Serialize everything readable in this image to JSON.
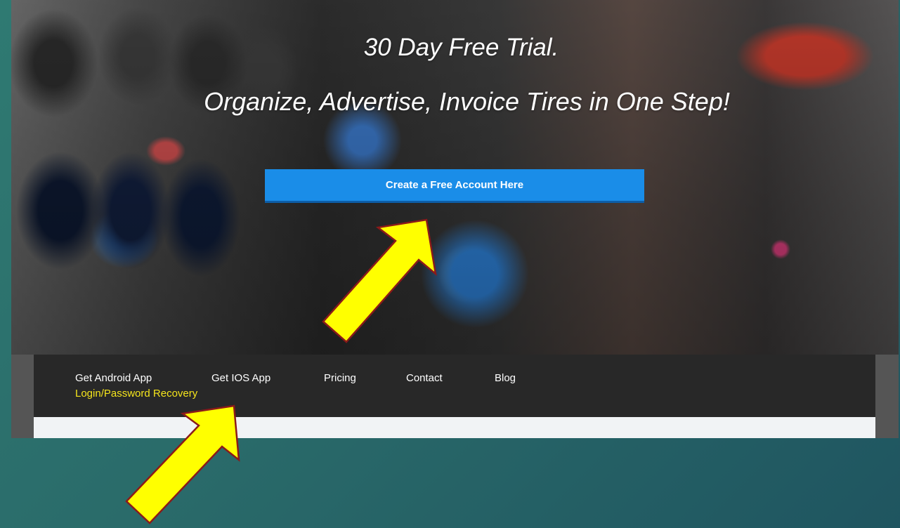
{
  "hero": {
    "headline_1": "30 Day Free Trial.",
    "headline_2": "Organize, Advertise, Invoice Tires in One Step!",
    "cta_label": "Create a Free Account Here"
  },
  "nav": {
    "items": [
      {
        "label": "Get Android App"
      },
      {
        "label": "Get IOS App"
      },
      {
        "label": "Pricing"
      },
      {
        "label": "Contact"
      },
      {
        "label": "Blog"
      }
    ],
    "recovery_label": "Login/Password Recovery"
  },
  "colors": {
    "cta": "#1a8de8",
    "navbar": "#282828",
    "recovery_link": "#f5e51c",
    "annotation_arrow": "#ffff00",
    "annotation_outline": "#8b1a1a",
    "slide_background": "#2a6b6a"
  },
  "annotations": [
    {
      "icon": "arrow-up-right-icon",
      "points_to": "create-account-button"
    },
    {
      "icon": "arrow-up-right-icon",
      "points_to": "login-recovery-link"
    }
  ]
}
